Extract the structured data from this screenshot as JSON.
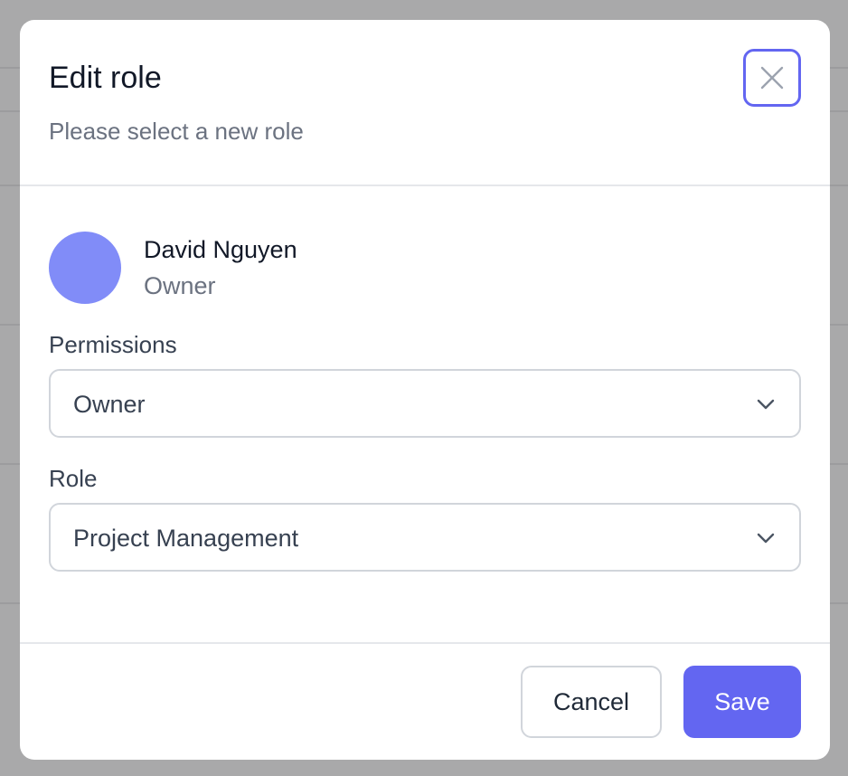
{
  "dialog": {
    "title": "Edit role",
    "subtitle": "Please select a new role",
    "close_icon": "close-icon"
  },
  "user": {
    "name": "David Nguyen",
    "role": "Owner",
    "avatar_color": "#818cf8"
  },
  "permissions": {
    "label": "Permissions",
    "selected": "Owner"
  },
  "role_field": {
    "label": "Role",
    "selected": "Project Management"
  },
  "footer": {
    "cancel_label": "Cancel",
    "save_label": "Save"
  },
  "colors": {
    "accent": "#6366f1",
    "overlay": "#a9a9aa"
  }
}
